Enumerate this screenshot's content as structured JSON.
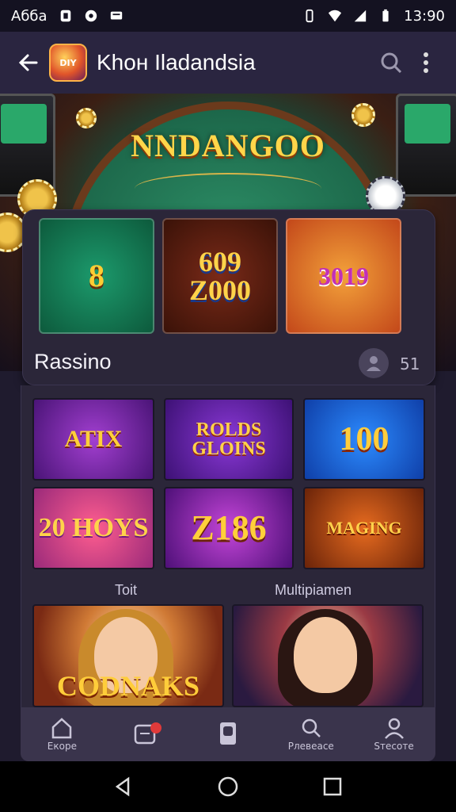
{
  "status_bar": {
    "left_text": "Aбба",
    "time": "13:90"
  },
  "app_bar": {
    "title": "Khон Iladandsia",
    "logo_text": "DIY"
  },
  "hero": {
    "title": "NNDANGOO"
  },
  "featured": {
    "tiles": [
      "8",
      "609\nZ000",
      "3019"
    ],
    "label": "Rassino",
    "count": "51"
  },
  "games": {
    "tiles": [
      "ATIX",
      "ROLDS GLOINS",
      "100",
      "20 HOYS",
      "Z186",
      "MAGING"
    ],
    "section_left": "Toit",
    "section_right": "Multipiamen",
    "big_tiles": [
      "CODNAKS",
      ""
    ]
  },
  "bottom_nav": {
    "items": [
      {
        "label": "Екоре",
        "icon": "home-icon"
      },
      {
        "label": "",
        "icon": "calendar-icon"
      },
      {
        "label": "",
        "icon": "phone-icon"
      },
      {
        "label": "Рлевеасе",
        "icon": "search-icon"
      },
      {
        "label": "Sтесоте",
        "icon": "profile-icon"
      }
    ]
  },
  "colors": {
    "accent": "#ffd24a",
    "background": "#1f1b2e",
    "notification": "#e03a3a"
  }
}
